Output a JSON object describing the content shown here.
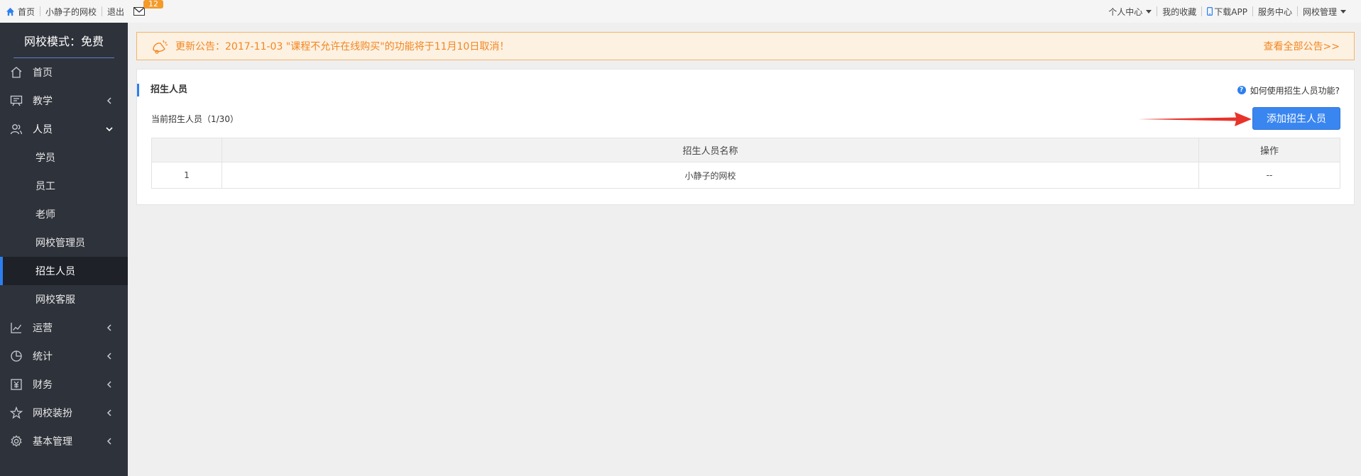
{
  "topbar": {
    "left": [
      {
        "name": "home-link",
        "label": "首页"
      },
      {
        "name": "school-name-link",
        "label": "小静子的网校"
      },
      {
        "name": "logout-link",
        "label": "退出"
      }
    ],
    "mail_badge": "12",
    "right": [
      {
        "name": "personal-center-menu",
        "label": "个人中心",
        "dropdown": true
      },
      {
        "name": "my-favorites-link",
        "label": "我的收藏",
        "dropdown": false
      },
      {
        "name": "download-app-link",
        "label": "下载APP",
        "dropdown": false,
        "phone": true
      },
      {
        "name": "service-center-link",
        "label": "服务中心",
        "dropdown": false
      },
      {
        "name": "school-admin-menu",
        "label": "网校管理",
        "dropdown": true
      }
    ]
  },
  "sidebar": {
    "title": "网校模式：免费",
    "items": [
      {
        "name": "menu-home",
        "label": "首页",
        "icon": "home-icon",
        "arrow": "none"
      },
      {
        "name": "menu-teaching",
        "label": "教学",
        "icon": "teaching-icon",
        "arrow": "left"
      },
      {
        "name": "menu-people",
        "label": "人员",
        "icon": "people-icon",
        "arrow": "down",
        "children": [
          {
            "name": "sub-students",
            "label": "学员"
          },
          {
            "name": "sub-staff",
            "label": "员工"
          },
          {
            "name": "sub-teachers",
            "label": "老师"
          },
          {
            "name": "sub-school-admins",
            "label": "网校管理员"
          },
          {
            "name": "sub-recruiters",
            "label": "招生人员",
            "active": true
          },
          {
            "name": "sub-customer-service",
            "label": "网校客服"
          }
        ]
      },
      {
        "name": "menu-operations",
        "label": "运营",
        "icon": "chart-line-icon",
        "arrow": "left"
      },
      {
        "name": "menu-statistics",
        "label": "统计",
        "icon": "pie-chart-icon",
        "arrow": "left"
      },
      {
        "name": "menu-finance",
        "label": "财务",
        "icon": "finance-icon",
        "arrow": "left"
      },
      {
        "name": "menu-decoration",
        "label": "网校装扮",
        "icon": "decoration-icon",
        "arrow": "left"
      },
      {
        "name": "menu-basic-settings",
        "label": "基本管理",
        "icon": "gear-icon",
        "arrow": "left"
      }
    ]
  },
  "notice": {
    "text": "更新公告：2017-11-03 \"课程不允许在线购买\"的功能将于11月10日取消！",
    "link": "查看全部公告>>"
  },
  "panel": {
    "title": "招生人员",
    "help": "如何使用招生人员功能?",
    "count": "当前招生人员（1/30）",
    "add_button": "添加招生人员",
    "columns": [
      "",
      "招生人员名称",
      "操作"
    ],
    "rows": [
      [
        "1",
        "小静子的网校",
        "--"
      ]
    ]
  },
  "colors": {
    "accent": "#3a86f0",
    "sidebar": "#2e323a",
    "notice": "#f3861f",
    "arrow": "#e8332b"
  }
}
